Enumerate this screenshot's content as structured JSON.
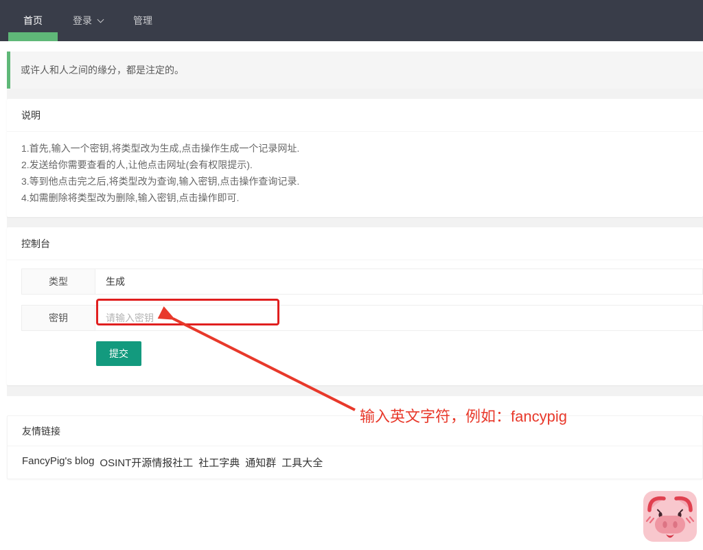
{
  "navbar": {
    "items": [
      {
        "label": "首页"
      },
      {
        "label": "登录"
      },
      {
        "label": "管理"
      }
    ]
  },
  "quote": {
    "text": "或许人和人之间的缘分，都是注定的。"
  },
  "instructions": {
    "title": "说明",
    "steps": [
      "1.首先,输入一个密钥,将类型改为生成,点击操作生成一个记录网址.",
      "2.发送给你需要查看的人,让他点击网址(会有权限提示).",
      "3.等到他点击完之后,将类型改为查询,输入密钥,点击操作查询记录.",
      "4.如需删除将类型改为删除,输入密钥,点击操作即可."
    ]
  },
  "console": {
    "title": "控制台",
    "type_label": "类型",
    "type_value": "生成",
    "key_label": "密钥",
    "key_placeholder": "请输入密钥",
    "submit_label": "提交"
  },
  "links": {
    "title": "友情链接",
    "items": [
      "FancyPig's blog",
      "OSINT开源情报社工",
      "社工字典",
      "通知群",
      "工具大全"
    ]
  },
  "annotation": {
    "text": "输入英文字符，例如：fancypig"
  },
  "colors": {
    "navbar_bg": "#393d49",
    "accent_green": "#5FB878",
    "button_teal": "#139a7e",
    "annotation_red": "#e8392b",
    "rect_red": "#e01f1f"
  }
}
